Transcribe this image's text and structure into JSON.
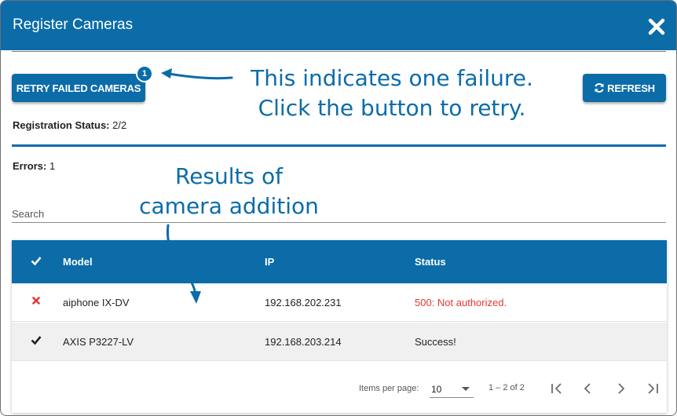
{
  "dialog": {
    "title": "Register Cameras"
  },
  "toolbar": {
    "retry_label": "RETRY FAILED CAMERAS",
    "retry_badge": "1",
    "refresh_label": "REFRESH"
  },
  "annotations": {
    "failure_line1": "This indicates one failure.",
    "failure_line2": "Click the button to retry.",
    "results_line1": "Results of",
    "results_line2": "camera addition"
  },
  "registration": {
    "label": "Registration Status:",
    "value": "2/2"
  },
  "errors": {
    "label": "Errors:",
    "value": "1"
  },
  "search": {
    "placeholder": "Search"
  },
  "table": {
    "columns": [
      "Model",
      "IP",
      "Status"
    ],
    "rows": [
      {
        "icon": "error-x-icon",
        "model": "aiphone IX-DV",
        "ip": "192.168.202.231",
        "status": "500: Not authorized."
      },
      {
        "icon": "check-icon",
        "model": "AXIS P3227-LV",
        "ip": "192.168.203.214",
        "status": "Success!"
      }
    ]
  },
  "pagination": {
    "items_label": "Items per page:",
    "page_size": "10",
    "range": "1 – 2 of 2"
  },
  "colors": {
    "primary": "#0b6ca8",
    "error": "#e53935"
  }
}
